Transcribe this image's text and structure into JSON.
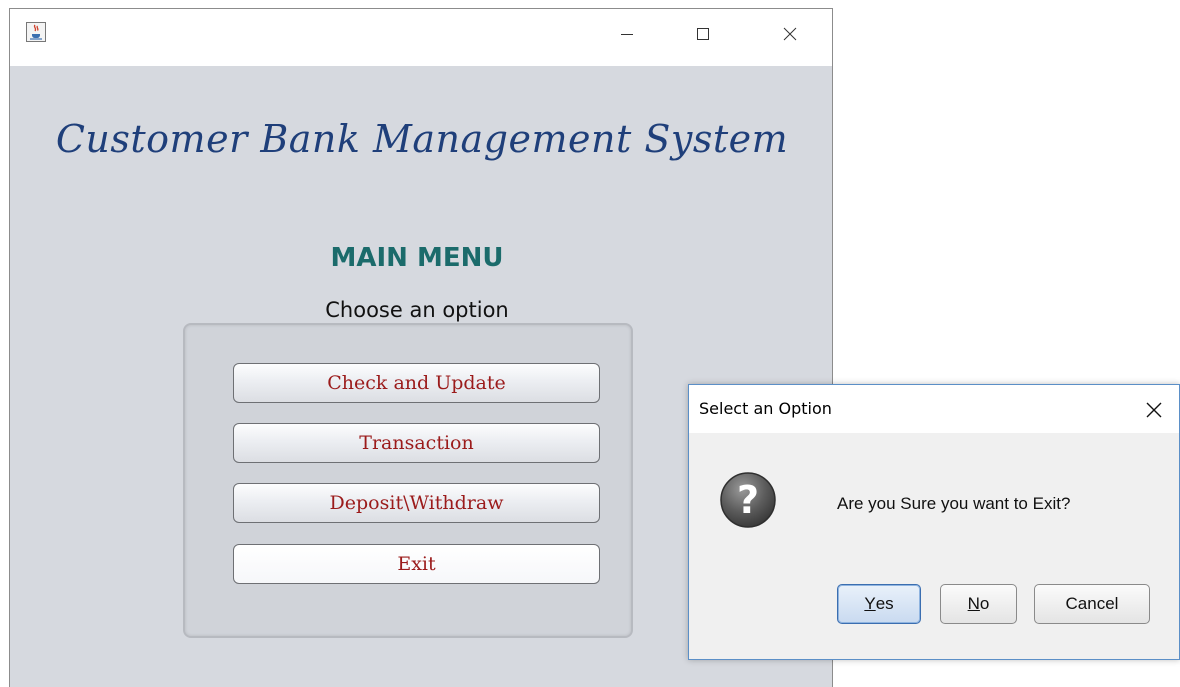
{
  "main_window": {
    "app_title": "Customer Bank Management System",
    "menu_title": "MAIN MENU",
    "menu_subtitle": "Choose an option",
    "buttons": [
      {
        "label": "Check and Update"
      },
      {
        "label": "Transaction"
      },
      {
        "label": "Deposit\\Withdraw"
      },
      {
        "label": "Exit"
      }
    ]
  },
  "dialog": {
    "title": "Select an Option",
    "message": "Are you Sure you want to Exit?",
    "yes_mnemonic": "Y",
    "yes_rest": "es",
    "no_mnemonic": "N",
    "no_rest": "o",
    "cancel_label": "Cancel"
  },
  "colors": {
    "app_title": "#1f3f7a",
    "menu_title": "#1b6b6b",
    "button_text": "#9b1b1b",
    "window_bg": "#d6d9df"
  },
  "icons": {
    "window_icon": "java-cup-icon",
    "dialog_icon": "question-icon"
  }
}
